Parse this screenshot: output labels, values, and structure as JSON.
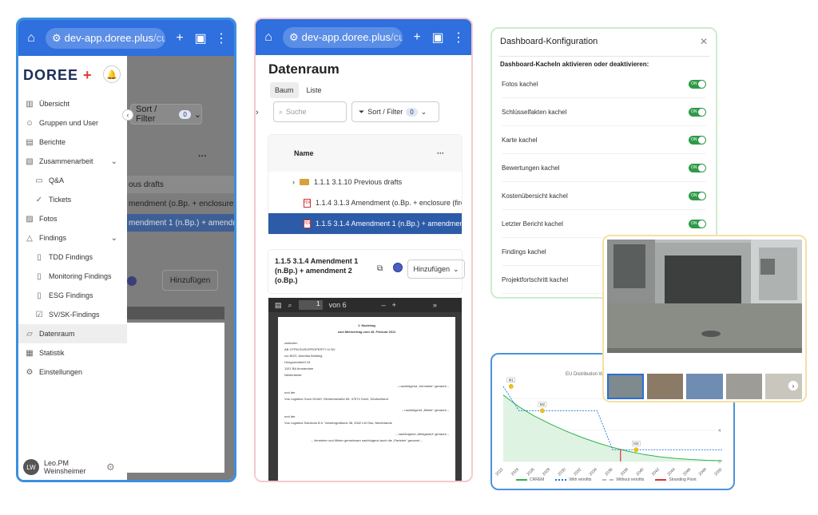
{
  "browser": {
    "url_main": "dev-app.doree.plus",
    "url_rest": "/custome"
  },
  "sidebar": {
    "logo_main": "DOREE",
    "logo_mark": "+",
    "items": [
      {
        "label": "Übersicht",
        "icon": "chart-icon"
      },
      {
        "label": "Gruppen und User",
        "icon": "users-icon"
      },
      {
        "label": "Berichte",
        "icon": "report-icon"
      },
      {
        "label": "Zusammenarbeit",
        "icon": "collab-icon",
        "expandable": true
      },
      {
        "label": "Q&A",
        "icon": "chat-icon",
        "sub": true
      },
      {
        "label": "Tickets",
        "icon": "ticket-icon",
        "sub": true
      },
      {
        "label": "Fotos",
        "icon": "image-icon"
      },
      {
        "label": "Findings",
        "icon": "warning-icon",
        "expandable": true
      },
      {
        "label": "TDD Findings",
        "icon": "doc-icon",
        "sub": true
      },
      {
        "label": "Monitoring Findings",
        "icon": "doc-icon",
        "sub": true
      },
      {
        "label": "ESG Findings",
        "icon": "doc-icon",
        "sub": true
      },
      {
        "label": "SV/SK-Findings",
        "icon": "check-icon",
        "sub": true
      },
      {
        "label": "Datenraum",
        "icon": "folder-icon",
        "active": true
      },
      {
        "label": "Statistik",
        "icon": "stats-icon"
      },
      {
        "label": "Einstellungen",
        "icon": "gear-icon"
      }
    ],
    "user_initials": "LW",
    "user_name_1": "Leo.PM",
    "user_name_2": "Weinsheimer"
  },
  "bg_page": {
    "filter_label": "Sort / Filter",
    "filter_count": "0",
    "rows": [
      "ous drafts",
      "mendment (o.Bp. + enclosure (fire safe",
      "mendment 1 (n.Bp.) + amendment 2 (c"
    ],
    "add_label": "Hinzufügen"
  },
  "dataroom": {
    "title": "Datenraum",
    "tabs": [
      "Baum",
      "Liste"
    ],
    "search_placeholder": "Suche",
    "filter_label": "Sort / Filter",
    "filter_count": "0",
    "column_name": "Name",
    "rows": [
      {
        "label": "1.1.1  3.1.10 Previous drafts",
        "type": "folder"
      },
      {
        "label": "1.1.4  3.1.3 Amendment (o.Bp. + enclosure (fire safe",
        "type": "pdf"
      },
      {
        "label": "1.1.5  3.1.4 Amendment 1 (n.Bp.) + amendment 2 (o",
        "type": "pdf",
        "selected": true
      }
    ],
    "detail_title": "1.1.5  3.1.4 Amendment 1 (n.Bp.) + amendment 2 (o.Bp.)",
    "add_label": "Hinzufügen",
    "viewer": {
      "page": "1",
      "of": "von 6",
      "doc_lines": [
        "1. Nachtrag",
        "zum Mietvertrag vom 28. Februar 2011",
        "zwischen",
        "AB CFPM EUROPROPERTY IV BV",
        "c/o BGG, Amerika Building",
        "Hoogoorddreef 15",
        "1101 BA Amsterdam",
        "Niederlande",
        "– nachfolgend „Vermieter“ genannt –",
        "und der",
        "Vos Logistics Goch GmbH, Siemensstraße 65, 47574 Goch, Deutschland",
        "– nachfolgend „Mieter“ genannt –",
        "und der",
        "Vos Logistics Solutions B.V. Vorstengrafdonk 38, 5342 LM Oss, Niederlande",
        "– nachfolgend „Mietgarant“ genannt –",
        "– Vermieter und Mieter gemeinsam nachfolgend auch die „Parteien“ genannt –"
      ]
    }
  },
  "dashboard_config": {
    "title": "Dashboard-Konfiguration",
    "subtitle": "Dashboard-Kacheln aktivieren oder deaktivieren:",
    "toggle_text": "ON",
    "tiles": [
      "Fotos kachel",
      "Schlüsselfakten kachel",
      "Karte kachel",
      "Bewertungen kachel",
      "Kostenübersicht kachel",
      "Letzter Bericht kachel",
      "Findings kachel",
      "Projektfortschritt kachel"
    ]
  },
  "chart_data": {
    "type": "line",
    "title": "EU Distribution Wa",
    "x": [
      2022,
      2024,
      2026,
      2028,
      2030,
      2032,
      2034,
      2036,
      2038,
      2040,
      2042,
      2044,
      2046,
      2048,
      2050
    ],
    "y_ticks": [
      "0",
      "4",
      "8"
    ],
    "ylim": [
      0,
      10
    ],
    "series": [
      {
        "name": "CRREM",
        "color": "#2db34a",
        "values": [
          8.5,
          7.0,
          5.8,
          4.8,
          3.9,
          3.1,
          2.4,
          1.8,
          1.3,
          0.9,
          0.6,
          0.4,
          0.25,
          0.15,
          0.1
        ]
      },
      {
        "name": "With retrofits",
        "color": "#1f6fd1",
        "values": [
          9.6,
          6.5,
          6.5,
          6.5,
          6.5,
          6.5,
          6.5,
          1.5,
          1.5,
          1.5,
          1.5,
          1.5,
          1.5,
          1.5,
          1.5
        ]
      },
      {
        "name": "Without retrofits",
        "color": "#bbbbbb",
        "values": [
          null
        ]
      },
      {
        "name": "Stranding Point",
        "color": "#d33",
        "values": [
          null
        ]
      }
    ],
    "markers": [
      {
        "label": "M1",
        "x": 2023,
        "y": 9.6
      },
      {
        "label": "M2",
        "x": 2027,
        "y": 6.5
      },
      {
        "label": "M3",
        "x": 2039,
        "y": 1.5
      }
    ],
    "stranding_x": 2037
  }
}
